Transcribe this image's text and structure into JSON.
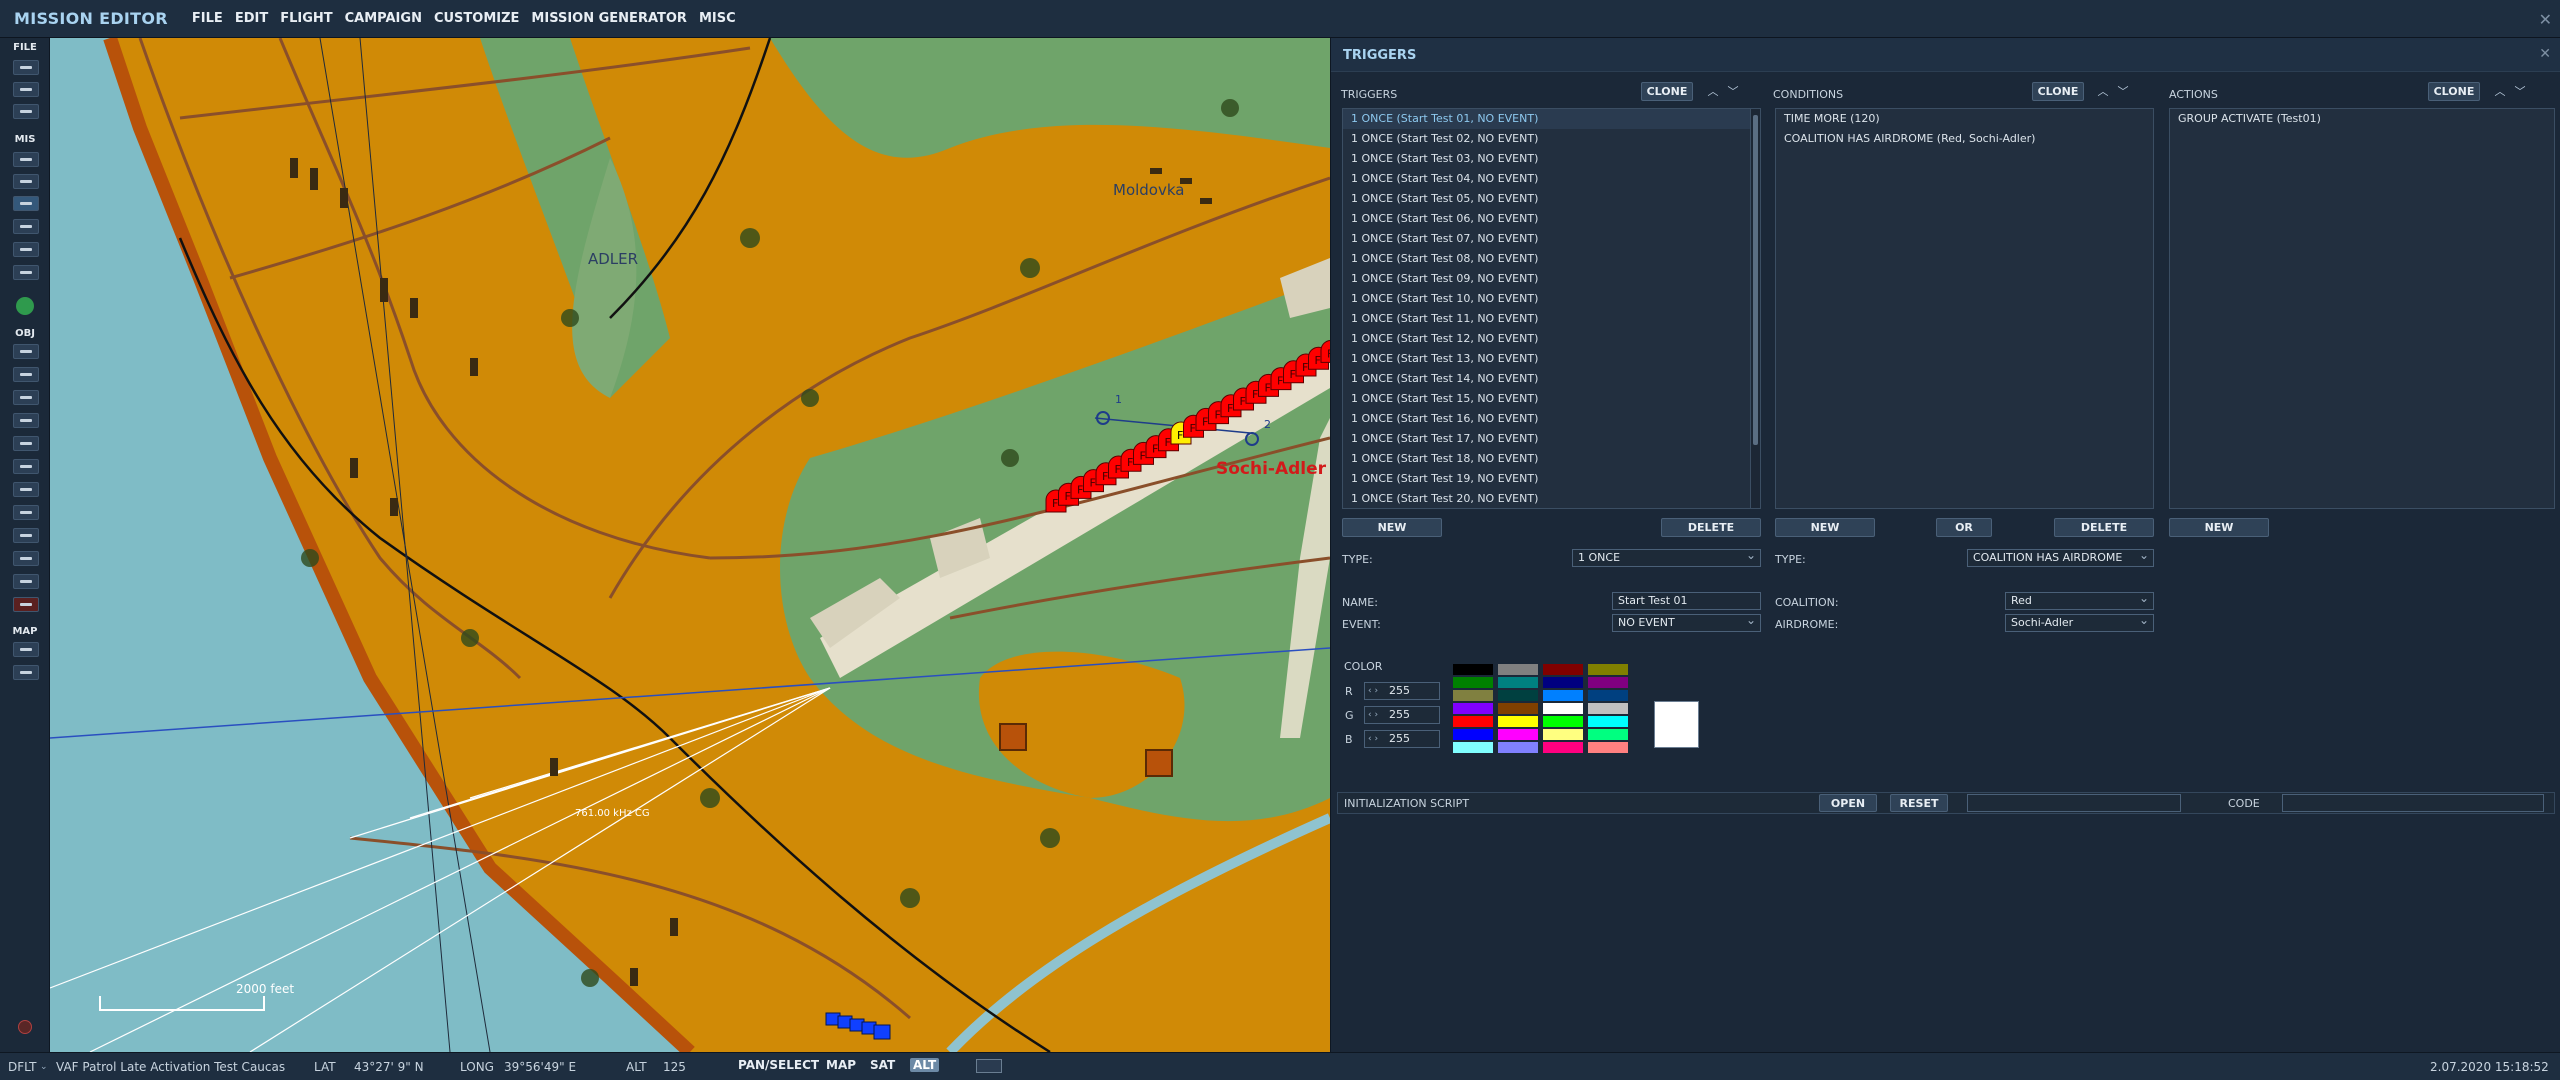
{
  "app": {
    "title": "MISSION EDITOR",
    "menu": [
      "FILE",
      "EDIT",
      "FLIGHT",
      "CAMPAIGN",
      "CUSTOMIZE",
      "MISSION GENERATOR",
      "MISC"
    ],
    "close_glyph": "✕"
  },
  "toolbar": {
    "sections": [
      "FILE",
      "MIS",
      "OBJ",
      "MAP"
    ]
  },
  "map": {
    "labels": {
      "moldovka": "Moldovka",
      "adler": "ADLER",
      "airbase": "Sochi-Adler",
      "scale": "2000 feet",
      "freq": "761.00 kHz CG",
      "wp1": "1",
      "wp2": "2",
      "unit_letter": "F"
    },
    "colors": {
      "sea": "#7fbcc6",
      "land": "#d08a06",
      "grass": "#6fa46a",
      "runway": "#e6e0cc",
      "unit_red": "#ff0000",
      "unit_selected": "#ffee00",
      "unit_blue": "#1040ff"
    }
  },
  "panel": {
    "title": "TRIGGERS",
    "close_glyph": "✕",
    "triggers": {
      "title": "TRIGGERS",
      "clone": "CLONE",
      "items": [
        "1 ONCE (Start Test 01, NO EVENT)",
        "1 ONCE (Start Test 02, NO EVENT)",
        "1 ONCE (Start Test 03, NO EVENT)",
        "1 ONCE (Start Test 04, NO EVENT)",
        "1 ONCE (Start Test 05, NO EVENT)",
        "1 ONCE (Start Test 06, NO EVENT)",
        "1 ONCE (Start Test 07, NO EVENT)",
        "1 ONCE (Start Test 08, NO EVENT)",
        "1 ONCE (Start Test 09, NO EVENT)",
        "1 ONCE (Start Test 10, NO EVENT)",
        "1 ONCE (Start Test 11, NO EVENT)",
        "1 ONCE (Start Test 12, NO EVENT)",
        "1 ONCE (Start Test 13, NO EVENT)",
        "1 ONCE (Start Test 14, NO EVENT)",
        "1 ONCE (Start Test 15, NO EVENT)",
        "1 ONCE (Start Test 16, NO EVENT)",
        "1 ONCE (Start Test 17, NO EVENT)",
        "1 ONCE (Start Test 18, NO EVENT)",
        "1 ONCE (Start Test 19, NO EVENT)",
        "1 ONCE (Start Test 20, NO EVENT)"
      ],
      "new": "NEW",
      "delete": "DELETE",
      "type_label": "TYPE:",
      "type_value": "1 ONCE",
      "name_label": "NAME:",
      "name_value": "Start Test 01",
      "event_label": "EVENT:",
      "event_value": "NO EVENT"
    },
    "conditions": {
      "title": "CONDITIONS",
      "clone": "CLONE",
      "items": [
        "TIME MORE (120)",
        "COALITION HAS AIRDROME (Red, Sochi-Adler)"
      ],
      "new": "NEW",
      "or": "OR",
      "delete": "DELETE",
      "type_label": "TYPE:",
      "type_value": "COALITION HAS AIRDROME",
      "coalition_label": "COALITION:",
      "coalition_value": "Red",
      "airdrome_label": "AIRDROME:",
      "airdrome_value": "Sochi-Adler"
    },
    "actions": {
      "title": "ACTIONS",
      "clone": "CLONE",
      "items": [
        "GROUP ACTIVATE (Test01)"
      ],
      "new": "NEW"
    },
    "color": {
      "label": "COLOR",
      "r_label": "R",
      "g_label": "G",
      "b_label": "B",
      "r": "255",
      "g": "255",
      "b": "255",
      "spin_glyph": "‹ ›",
      "swatches": [
        "#000000",
        "#808080",
        "#800000",
        "#808000",
        "#008000",
        "#008080",
        "#000080",
        "#800080",
        "#808040",
        "#004040",
        "#0080ff",
        "#004080",
        "#8000ff",
        "#804000",
        "#ffffff",
        "#c0c0c0",
        "#ff0000",
        "#ffff00",
        "#00ff00",
        "#00ffff",
        "#0000ff",
        "#ff00ff",
        "#ffff80",
        "#00ff80",
        "#80ffff",
        "#8080ff",
        "#ff0080",
        "#ff8080"
      ],
      "preview": "#ffffff"
    },
    "init": {
      "label": "INITIALIZATION SCRIPT",
      "open": "OPEN",
      "reset": "RESET",
      "code_label": "CODE",
      "script_value": "",
      "code_value": ""
    }
  },
  "status": {
    "profile": "DFLT",
    "mission": "VAF Patrol Late Activation Test Caucas",
    "lat_label": "LAT",
    "lat": "43°27' 9\" N",
    "long_label": "LONG",
    "long": "39°56'49\" E",
    "alt_label": "ALT",
    "alt": "125",
    "pan": "PAN/SELECT",
    "map": "MAP",
    "sat": "SAT",
    "alt_btn": "ALT",
    "datetime": "2.07.2020 15:18:52"
  }
}
